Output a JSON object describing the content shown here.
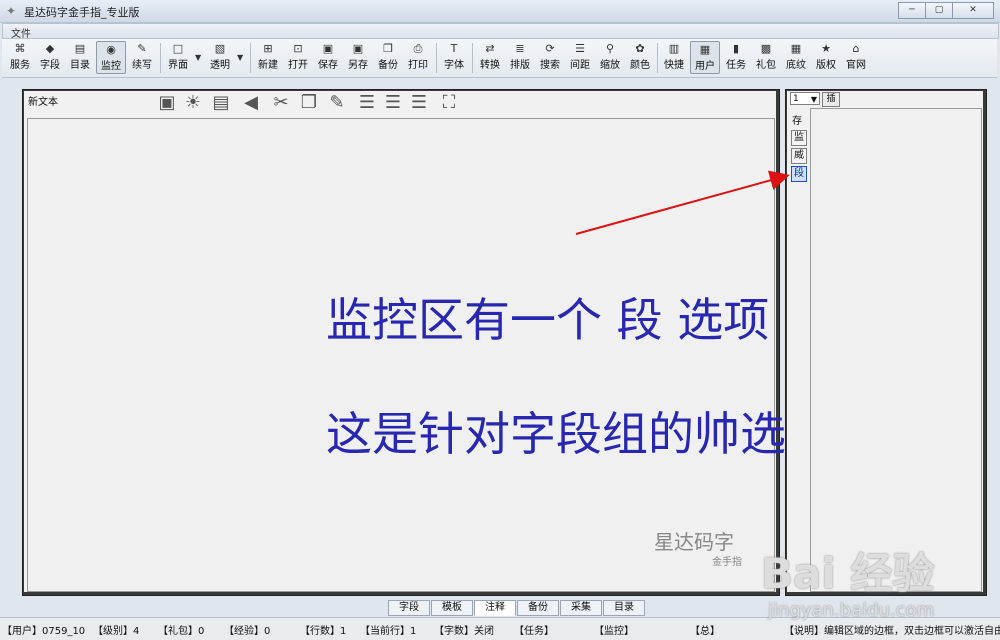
{
  "window": {
    "title": "星达码字金手指_专业版",
    "controls": [
      "minimize-icon",
      "maximize-icon",
      "close-icon"
    ]
  },
  "menubar": {
    "items": [
      "文件"
    ]
  },
  "toolbar": {
    "items": [
      {
        "label": "服务",
        "icon": "rss-icon"
      },
      {
        "label": "字段",
        "icon": "diamond-icon"
      },
      {
        "label": "目录",
        "icon": "folder-icon"
      },
      {
        "label": "监控",
        "icon": "monitor-icon",
        "active": true
      },
      {
        "label": "续写",
        "icon": "pen-icon"
      },
      {
        "label": "界面",
        "icon": "window-icon"
      },
      {
        "label": "透明",
        "icon": "image-icon"
      },
      {
        "label": "新建",
        "icon": "new-file-icon"
      },
      {
        "label": "打开",
        "icon": "open-icon"
      },
      {
        "label": "保存",
        "icon": "save-icon"
      },
      {
        "label": "另存",
        "icon": "save-as-icon"
      },
      {
        "label": "备份",
        "icon": "backup-icon"
      },
      {
        "label": "打印",
        "icon": "print-icon"
      },
      {
        "label": "字体",
        "icon": "font-icon"
      },
      {
        "label": "转换",
        "icon": "convert-icon"
      },
      {
        "label": "排版",
        "icon": "layout-icon"
      },
      {
        "label": "搜索",
        "icon": "search-icon"
      },
      {
        "label": "间距",
        "icon": "spacing-icon"
      },
      {
        "label": "缩放",
        "icon": "zoom-icon"
      },
      {
        "label": "颜色",
        "icon": "color-icon"
      },
      {
        "label": "快捷",
        "icon": "shortcut-icon"
      },
      {
        "label": "用户",
        "icon": "user-icon",
        "active": true
      },
      {
        "label": "任务",
        "icon": "task-icon"
      },
      {
        "label": "礼包",
        "icon": "gift-icon"
      },
      {
        "label": "底纹",
        "icon": "texture-icon"
      },
      {
        "label": "版权",
        "icon": "star-icon"
      },
      {
        "label": "官网",
        "icon": "home-icon"
      }
    ]
  },
  "editor": {
    "title": "新文本",
    "icons": [
      "save-icon",
      "bulb-icon",
      "document-icon",
      "back-icon",
      "cut-icon",
      "copy-icon",
      "edit-icon",
      "align-left-icon",
      "align-center-icon",
      "align-right-icon",
      "fullscreen-icon"
    ],
    "overlay_line1": "监控区有一个 段 选项",
    "overlay_line2": "这是针对字段组的帅选监控",
    "watermark_logo": "星达码字",
    "watermark_sub": "金手指"
  },
  "right_panel": {
    "select_value": "1",
    "insert_label": "插",
    "store_label": "存",
    "buttons": [
      "监",
      "威",
      "段"
    ],
    "active_button": "段"
  },
  "bottom_tabs": {
    "items": [
      "字段",
      "模板",
      "注释",
      "备份",
      "采集",
      "目录"
    ],
    "active": "注释"
  },
  "statusbar": {
    "user": "【用户】0759_10",
    "level": "【级别】4",
    "gift": "【礼包】0",
    "exp": "【经验】0",
    "lines": "【行数】1",
    "current_line": "【当前行】1",
    "chars": "【字数】关闭",
    "task": "【任务】",
    "monitor": "【监控】",
    "total": "【总】",
    "description": "【说明】编辑区域的边框，双击边框可以激活自由"
  },
  "watermark": {
    "site_logo": "Bai 经验",
    "site_url": "jingyan.baidu.com"
  },
  "colors": {
    "overlay_text": "#2727b0",
    "arrow": "#d11",
    "frame_dark": "#3a3a3a"
  }
}
